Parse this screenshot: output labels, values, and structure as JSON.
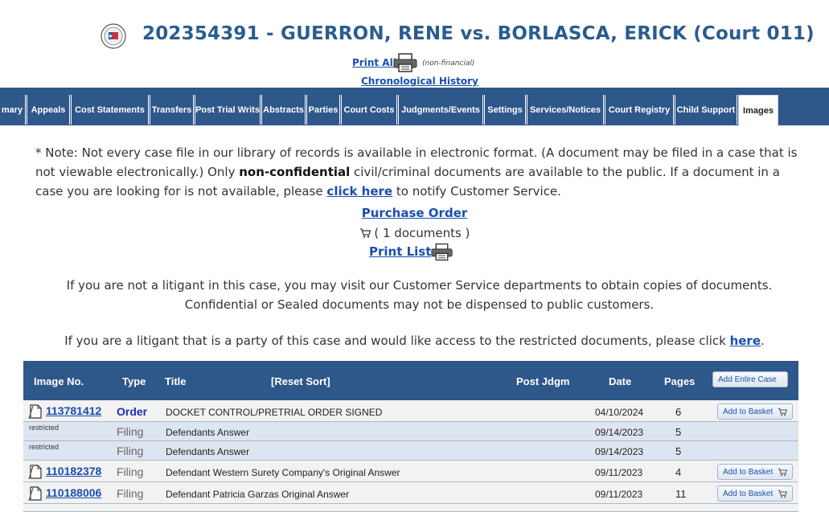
{
  "header": {
    "case_title": "202354391 - GUERRON, RENE vs. BORLASCA, ERICK (Court 011)",
    "print_all": "Print All",
    "non_financial": "(non-financial)",
    "chronological_history": "Chronological History",
    "seal_icon": "county-seal-icon"
  },
  "tabs": [
    "mary",
    "Appeals",
    "Cost Statements",
    "Transfers",
    "Post Trial Writs",
    "Abstracts",
    "Parties",
    "Court Costs",
    "Judgments/Events",
    "Settings",
    "Services/Notices",
    "Court Registry",
    "Child Support",
    "Images"
  ],
  "active_tab": "Images",
  "note": {
    "p1": "* Note: Not every case file in our library of records is available in electronic format. (A document may be filed in a case that is not viewable electronically.) Only ",
    "bold": "non-confidential",
    "p2": " civil/criminal documents are available to the public. If a document in a case you are looking for is not available, please ",
    "link": "click here",
    "p3": " to notify Customer Service."
  },
  "purchase_order": "Purchase Order",
  "documents_count": "( 1 documents )",
  "print_list": "Print List",
  "litigant_note": "If you are not a litigant in this case, you may visit our Customer Service departments to obtain copies of documents. Confidential or Sealed documents may not be dispensed to public customers.",
  "restricted_note": {
    "text": "If you are a litigant that is a party of this case and would like access to the restricted documents, please click ",
    "link": "here",
    "end": "."
  },
  "table": {
    "headers": {
      "image_no": "Image No.",
      "type": "Type",
      "title": "Title",
      "reset_sort": "[Reset Sort]",
      "post_jdgm": "Post Jdgm",
      "date": "Date",
      "pages": "Pages"
    },
    "add_entire_case": "Add Entire Case",
    "add_to_basket": "Add to Basket",
    "rows": [
      {
        "image_no": "113781412",
        "restricted": "",
        "type": "Order",
        "title": "DOCKET CONTROL/PRETRIAL ORDER SIGNED",
        "date": "04/10/2024",
        "pages": "6"
      },
      {
        "image_no": "",
        "restricted": "restricted",
        "type": "Filing",
        "title": "Defendants Answer",
        "date": "09/14/2023",
        "pages": "5"
      },
      {
        "image_no": "",
        "restricted": "restricted",
        "type": "Filing",
        "title": "Defendants Answer",
        "date": "09/14/2023",
        "pages": "5"
      },
      {
        "image_no": "110182378",
        "restricted": "",
        "type": "Filing",
        "title": "Defendant Western Surety Company's Original Answer",
        "date": "09/11/2023",
        "pages": "4"
      },
      {
        "image_no": "110188006",
        "restricted": "",
        "type": "Filing",
        "title": "Defendant Patricia Garzas Original Answer",
        "date": "09/11/2023",
        "pages": "11"
      }
    ]
  },
  "colors": {
    "nav_blue": "#2e578a",
    "title_blue": "#2b5c8f",
    "link_blue": "#1a4fb0",
    "row_alt": "#dde5f0"
  }
}
